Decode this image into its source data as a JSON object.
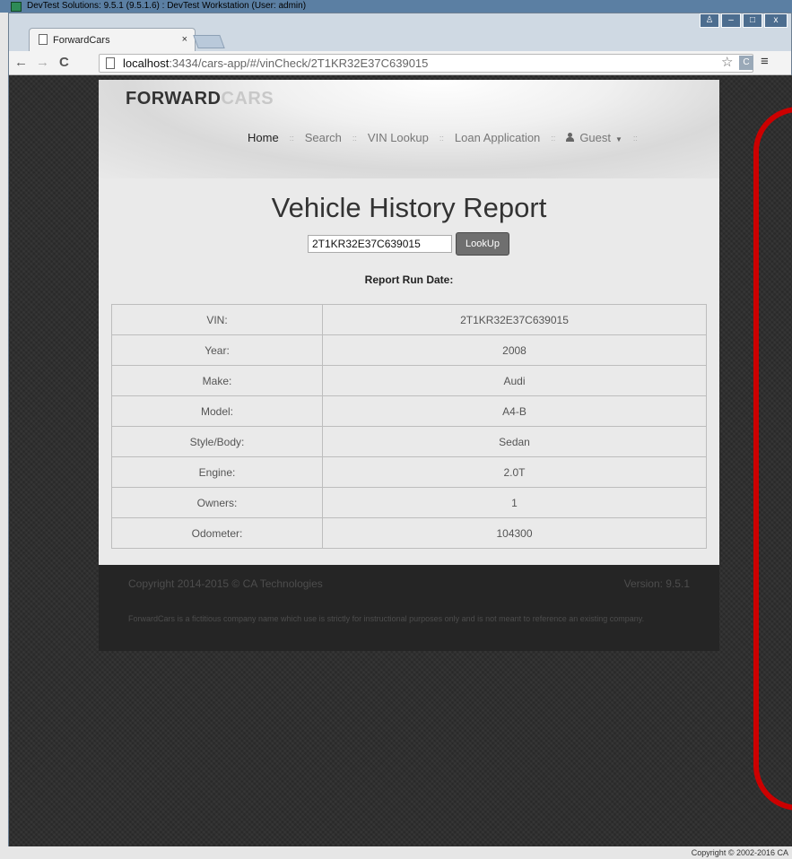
{
  "host_app": {
    "title": "DevTest Solutions: 9.5.1 (9.5.1.6) : DevTest Workstation (User: admin)",
    "bottom_text": "Copyright © 2002-2016 CA"
  },
  "browser": {
    "tab_title": "ForwardCars",
    "tab_close": "×",
    "url_host": "localhost",
    "url_path": ":3434/cars-app/#/vinCheck/2T1KR32E37C639015",
    "window_controls": {
      "user": "♙",
      "minimize": "–",
      "maximize": "□",
      "close": "x"
    },
    "ext_label": "C"
  },
  "site": {
    "logo_main": "FORWARD",
    "logo_accent": "CARS",
    "nav": [
      {
        "label": "Home"
      },
      {
        "label": "Search"
      },
      {
        "label": "VIN Lookup"
      },
      {
        "label": "Loan Application"
      },
      {
        "label": "Guest"
      }
    ],
    "nav_sep": "::"
  },
  "report": {
    "title": "Vehicle History Report",
    "vin_value": "2T1KR32E37C639015",
    "lookup_label": "LookUp",
    "run_date_label": "Report Run Date:",
    "rows": [
      {
        "key": "VIN:",
        "value": "2T1KR32E37C639015"
      },
      {
        "key": "Year:",
        "value": "2008"
      },
      {
        "key": "Make:",
        "value": "Audi"
      },
      {
        "key": "Model:",
        "value": "A4-B"
      },
      {
        "key": "Style/Body:",
        "value": "Sedan"
      },
      {
        "key": "Engine:",
        "value": "2.0T"
      },
      {
        "key": "Owners:",
        "value": "1"
      },
      {
        "key": "Odometer:",
        "value": "104300"
      }
    ]
  },
  "footer": {
    "copyright": "Copyright 2014-2015 © CA Technologies",
    "version": "Version: 9.5.1",
    "disclaimer": "ForwardCars is a fictitious company name which use is strictly for instructional purposes only and is not meant to reference an existing company."
  },
  "colors": {
    "annotation": "#cc0000",
    "footer_bg": "#252525",
    "lookup_button": "#6f6f6f"
  }
}
